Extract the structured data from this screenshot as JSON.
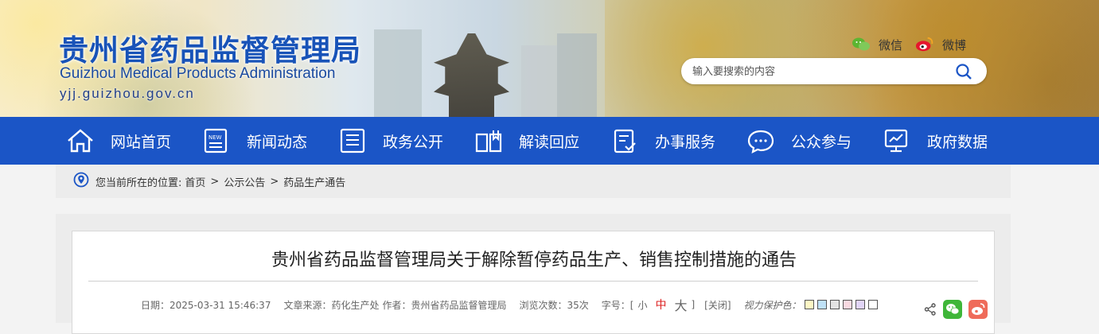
{
  "header": {
    "title_cn": "贵州省药品监督管理局",
    "title_en": "Guizhou Medical Products Administration",
    "url": "yjj.guizhou.gov.cn",
    "social": {
      "weixin": "微信",
      "weibo": "微博"
    },
    "search": {
      "placeholder": "输入要搜索的内容",
      "value": ""
    }
  },
  "nav": {
    "items": [
      {
        "label": "网站首页",
        "icon": "home-icon"
      },
      {
        "label": "新闻动态",
        "icon": "news-icon"
      },
      {
        "label": "政务公开",
        "icon": "document-icon"
      },
      {
        "label": "解读回应",
        "icon": "book-icon"
      },
      {
        "label": "办事服务",
        "icon": "service-icon"
      },
      {
        "label": "公众参与",
        "icon": "chat-icon"
      },
      {
        "label": "政府数据",
        "icon": "data-icon"
      }
    ]
  },
  "breadcrumb": {
    "prefix": "您当前所在的位置:",
    "items": [
      "首页",
      "公示公告",
      "药品生产通告"
    ],
    "separator": ">"
  },
  "article": {
    "title": "贵州省药品监督管理局关于解除暂停药品生产、销售控制措施的通告",
    "meta": {
      "date": "日期：2025-03-31 15:46:37",
      "source": "文章来源：药化生产处",
      "author": "作者：贵州省药品监督管理局",
      "views": "浏览次数：35次",
      "font_label": "字号：[",
      "font_small": "小",
      "font_mid": "中",
      "font_big": "大",
      "font_end": "]",
      "close": "[关闭]",
      "eye_label": "视力保护色："
    },
    "eye_colors": [
      "#fdf6c4",
      "#bfe1f7",
      "#e3e3e3",
      "#f9d9e1",
      "#e1d5f7",
      "#ffffff"
    ],
    "accent_color": "#dd2222"
  },
  "theme": {
    "nav_bg": "#1b55c6",
    "brand_blue": "#1853b8"
  }
}
